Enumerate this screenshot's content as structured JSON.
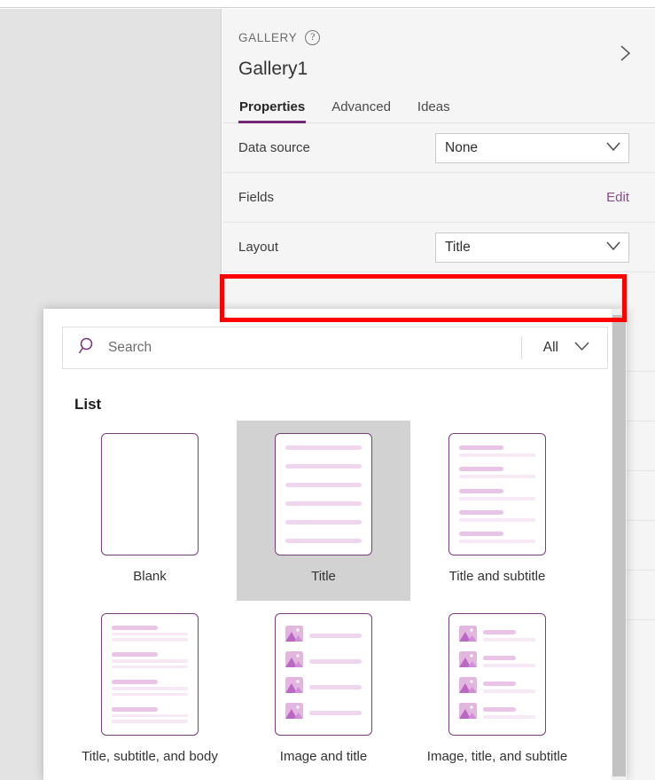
{
  "properties_panel": {
    "eyebrow": "GALLERY",
    "help_icon": "question-circle-icon",
    "collapse_icon": "chevron-right-icon",
    "control_name": "Gallery1",
    "tabs": [
      {
        "label": "Properties",
        "active": true
      },
      {
        "label": "Advanced",
        "active": false
      },
      {
        "label": "Ideas",
        "active": false
      }
    ],
    "rows": [
      {
        "label": "Data source",
        "type": "dropdown",
        "value": "None"
      },
      {
        "label": "Fields",
        "type": "link",
        "value": "Edit"
      },
      {
        "label": "Layout",
        "type": "dropdown",
        "value": "Title"
      }
    ]
  },
  "annotation": {
    "shape": "rectangle",
    "color": "#ff0000",
    "targets": "Layout row"
  },
  "layout_flyout": {
    "search": {
      "icon": "search-icon",
      "placeholder": "Search",
      "value": ""
    },
    "filter": {
      "label": "All",
      "icon": "chevron-down-icon"
    },
    "section_title": "List",
    "cards": [
      {
        "label": "Blank",
        "thumb": "blank",
        "selected": false
      },
      {
        "label": "Title",
        "thumb": "title",
        "selected": true
      },
      {
        "label": "Title and subtitle",
        "thumb": "title-subtitle",
        "selected": false
      },
      {
        "label": "Title, subtitle, and body",
        "thumb": "title-subtitle-body",
        "selected": false
      },
      {
        "label": "Image and title",
        "thumb": "image-title",
        "selected": false
      },
      {
        "label": "Image, title, and subtitle",
        "thumb": "image-title-subtitle",
        "selected": false
      }
    ]
  },
  "colors": {
    "accent_purple": "#742774",
    "link_purple": "#8a4b8a",
    "thumb_border": "#7a3e7a",
    "bar_pink": "#f0d5ee",
    "selected_card_bg": "#d2d2d2",
    "panel_bg": "#f5f5f5",
    "canvas_bg": "#e3e3e3",
    "annotation_red": "#ff0000"
  }
}
